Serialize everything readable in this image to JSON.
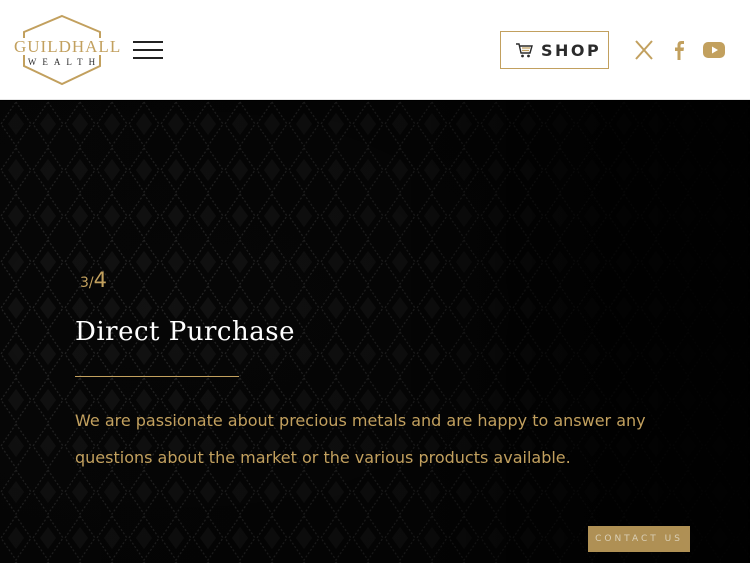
{
  "brand": {
    "name_line1": "GUILDHALL",
    "name_line2": "WEALTH",
    "gold": "#c2a05e",
    "dark": "#2b2b2b"
  },
  "header": {
    "menu_icon": "hamburger-menu-icon",
    "shop_label": "SHOP",
    "shop_icon": "shopping-cart-icon",
    "social": [
      "x-twitter-icon",
      "facebook-icon",
      "youtube-icon"
    ]
  },
  "slide": {
    "current": "3",
    "separator": "/",
    "total": "4",
    "title": "Direct Purchase",
    "text": "We are passionate about precious metals and are happy to answer any questions about the market or the various products available."
  },
  "contact": {
    "label": "CONTACT US"
  }
}
